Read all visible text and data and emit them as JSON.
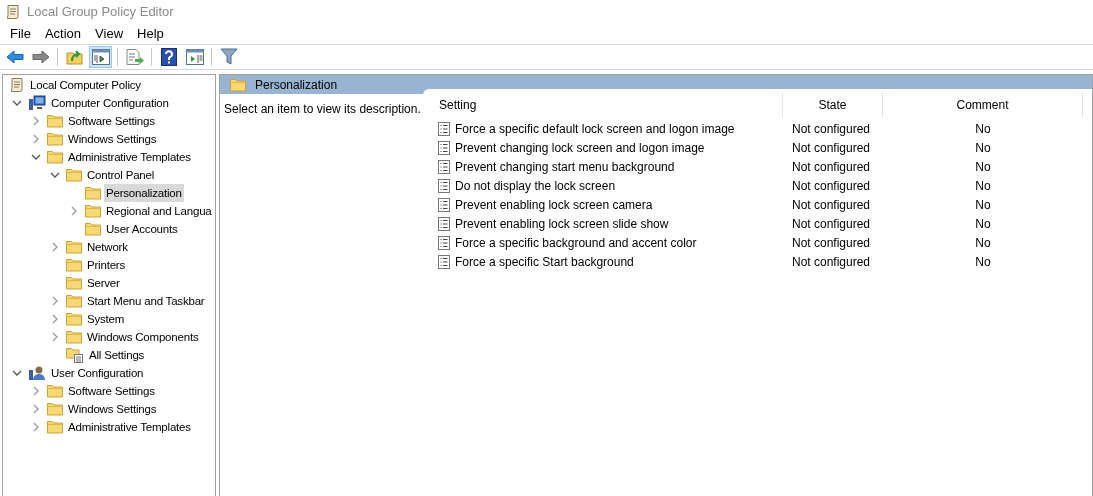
{
  "window": {
    "title": "Local Group Policy Editor"
  },
  "menu": [
    "File",
    "Action",
    "View",
    "Help"
  ],
  "toolbar": [
    {
      "kind": "back",
      "pressed": false
    },
    {
      "kind": "forward",
      "pressed": false
    },
    {
      "kind": "sep"
    },
    {
      "kind": "up",
      "pressed": false
    },
    {
      "kind": "tree",
      "pressed": true
    },
    {
      "kind": "sep"
    },
    {
      "kind": "export",
      "pressed": false
    },
    {
      "kind": "sep"
    },
    {
      "kind": "help",
      "pressed": false
    },
    {
      "kind": "pane",
      "pressed": false
    },
    {
      "kind": "sep"
    },
    {
      "kind": "filter",
      "pressed": false
    }
  ],
  "tree": [
    {
      "label": "Local Computer Policy",
      "kind": "policy",
      "selected": false,
      "children": [
        {
          "label": "Computer Configuration",
          "kind": "computer",
          "selected": false,
          "expanded": true,
          "children": [
            {
              "label": "Software Settings",
              "kind": "folder",
              "selected": false,
              "expanded": false
            },
            {
              "label": "Windows Settings",
              "kind": "folder",
              "selected": false,
              "expanded": false
            },
            {
              "label": "Administrative Templates",
              "kind": "folder",
              "selected": false,
              "expanded": true,
              "children": [
                {
                  "label": "Control Panel",
                  "kind": "folder",
                  "selected": false,
                  "expanded": true,
                  "children": [
                    {
                      "label": "Personalization",
                      "kind": "folder",
                      "selected": true
                    },
                    {
                      "label": "Regional and Langua",
                      "kind": "folder",
                      "selected": false,
                      "expanded": false
                    },
                    {
                      "label": "User Accounts",
                      "kind": "folder",
                      "selected": false
                    }
                  ]
                },
                {
                  "label": "Network",
                  "kind": "folder",
                  "selected": false,
                  "expanded": false
                },
                {
                  "label": "Printers",
                  "kind": "folder",
                  "selected": false
                },
                {
                  "label": "Server",
                  "kind": "folder",
                  "selected": false
                },
                {
                  "label": "Start Menu and Taskbar",
                  "kind": "folder",
                  "selected": false,
                  "expanded": false
                },
                {
                  "label": "System",
                  "kind": "folder",
                  "selected": false,
                  "expanded": false
                },
                {
                  "label": "Windows Components",
                  "kind": "folder",
                  "selected": false,
                  "expanded": false
                },
                {
                  "label": "All Settings",
                  "kind": "allsettings",
                  "selected": false
                }
              ]
            }
          ]
        },
        {
          "label": "User Configuration",
          "kind": "user",
          "selected": false,
          "expanded": true,
          "children": [
            {
              "label": "Software Settings",
              "kind": "folder",
              "selected": false,
              "expanded": false
            },
            {
              "label": "Windows Settings",
              "kind": "folder",
              "selected": false,
              "expanded": false
            },
            {
              "label": "Administrative Templates",
              "kind": "folder",
              "selected": false,
              "expanded": false
            }
          ]
        }
      ]
    }
  ],
  "details": {
    "title": "Personalization",
    "description": "Select an item to view its description.",
    "columns": [
      "Setting",
      "State",
      "Comment"
    ],
    "rows": [
      {
        "setting": "Force a specific default lock screen and logon image",
        "state": "Not configured",
        "comment": "No"
      },
      {
        "setting": "Prevent changing lock screen and logon image",
        "state": "Not configured",
        "comment": "No"
      },
      {
        "setting": "Prevent changing start menu background",
        "state": "Not configured",
        "comment": "No"
      },
      {
        "setting": "Do not display the lock screen",
        "state": "Not configured",
        "comment": "No"
      },
      {
        "setting": "Prevent enabling lock screen camera",
        "state": "Not configured",
        "comment": "No"
      },
      {
        "setting": "Prevent enabling lock screen slide show",
        "state": "Not configured",
        "comment": "No"
      },
      {
        "setting": "Force a specific background and accent color",
        "state": "Not configured",
        "comment": "No"
      },
      {
        "setting": "Force a specific Start background",
        "state": "Not configured",
        "comment": "No"
      }
    ]
  }
}
